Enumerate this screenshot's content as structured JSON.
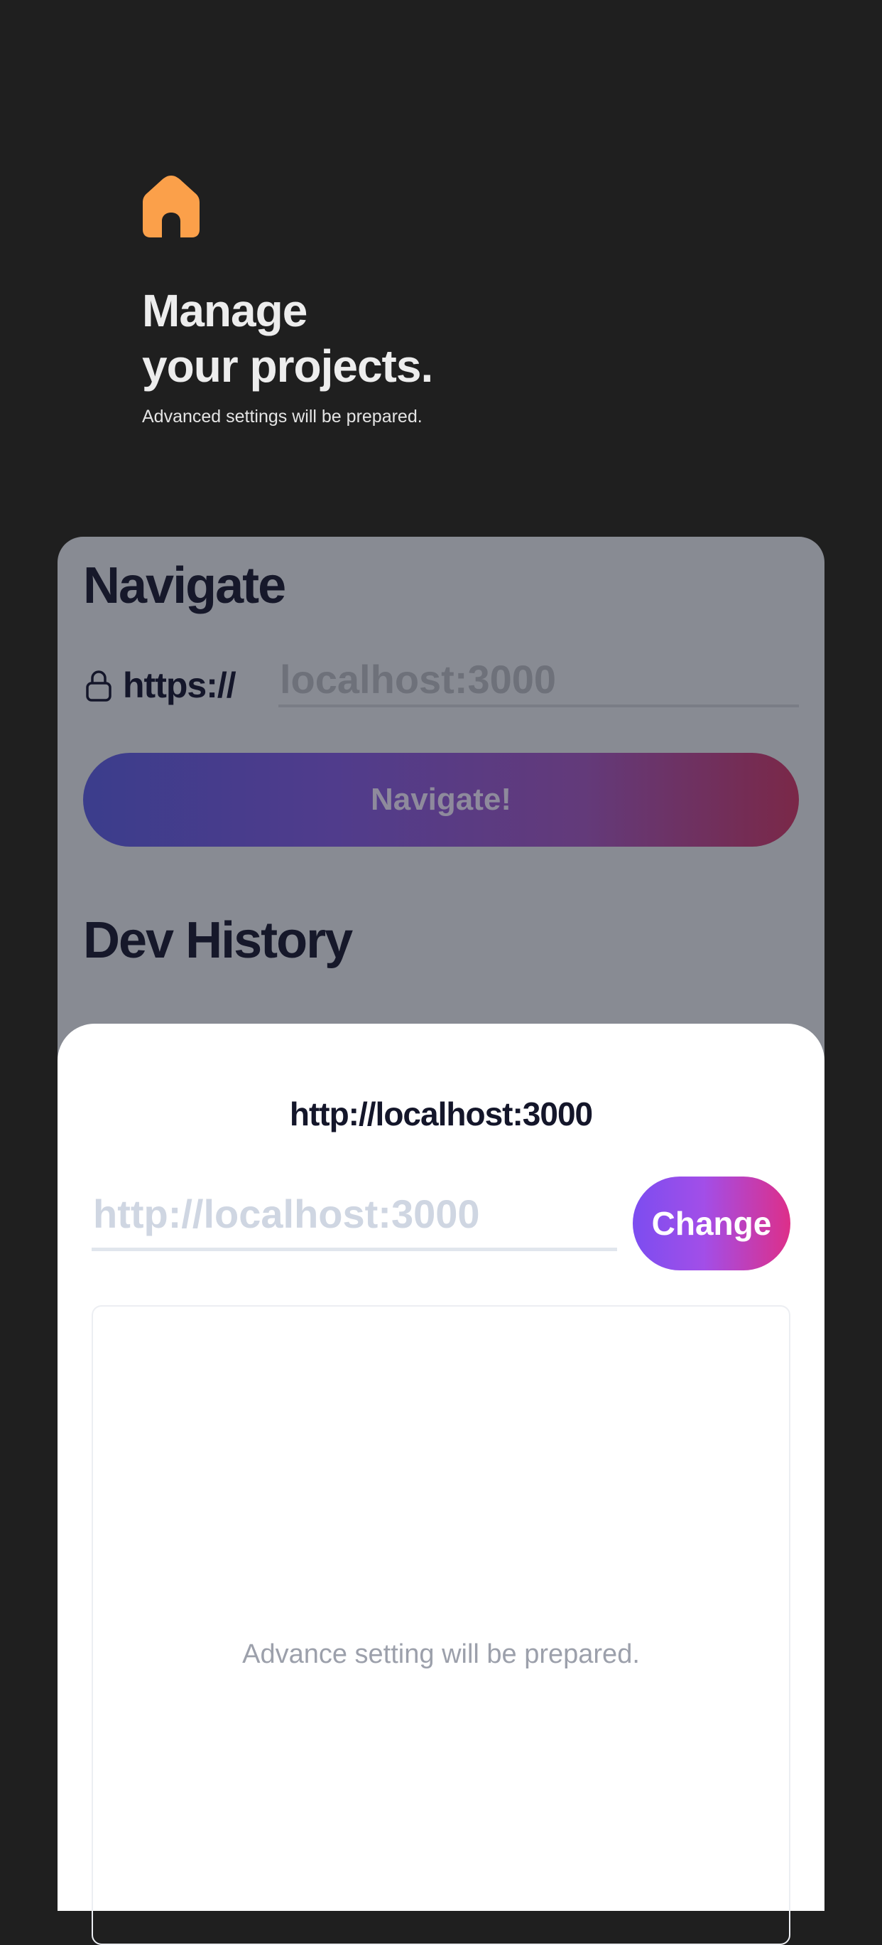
{
  "hero": {
    "title_line1": "Manage",
    "title_line2": "your projects.",
    "subtitle": "Advanced settings will be prepared.",
    "icon": "home-icon",
    "icon_color": "#fba04a"
  },
  "navigate": {
    "heading": "Navigate",
    "scheme": "https://",
    "lock_icon": "lock-icon",
    "url_placeholder": "localhost:3000",
    "button_label": "Navigate!"
  },
  "dev_history": {
    "heading": "Dev History"
  },
  "sheet": {
    "title": "http://localhost:3000",
    "input_placeholder": "http://localhost:3000",
    "change_label": "Change",
    "panel_text": "Advance setting will be prepared."
  },
  "colors": {
    "background": "#1f1f1f",
    "card_overlay": "#888b93",
    "accent_orange": "#fba04a",
    "change_gradient_start": "#7c4df0",
    "change_gradient_end": "#dd2f89"
  }
}
